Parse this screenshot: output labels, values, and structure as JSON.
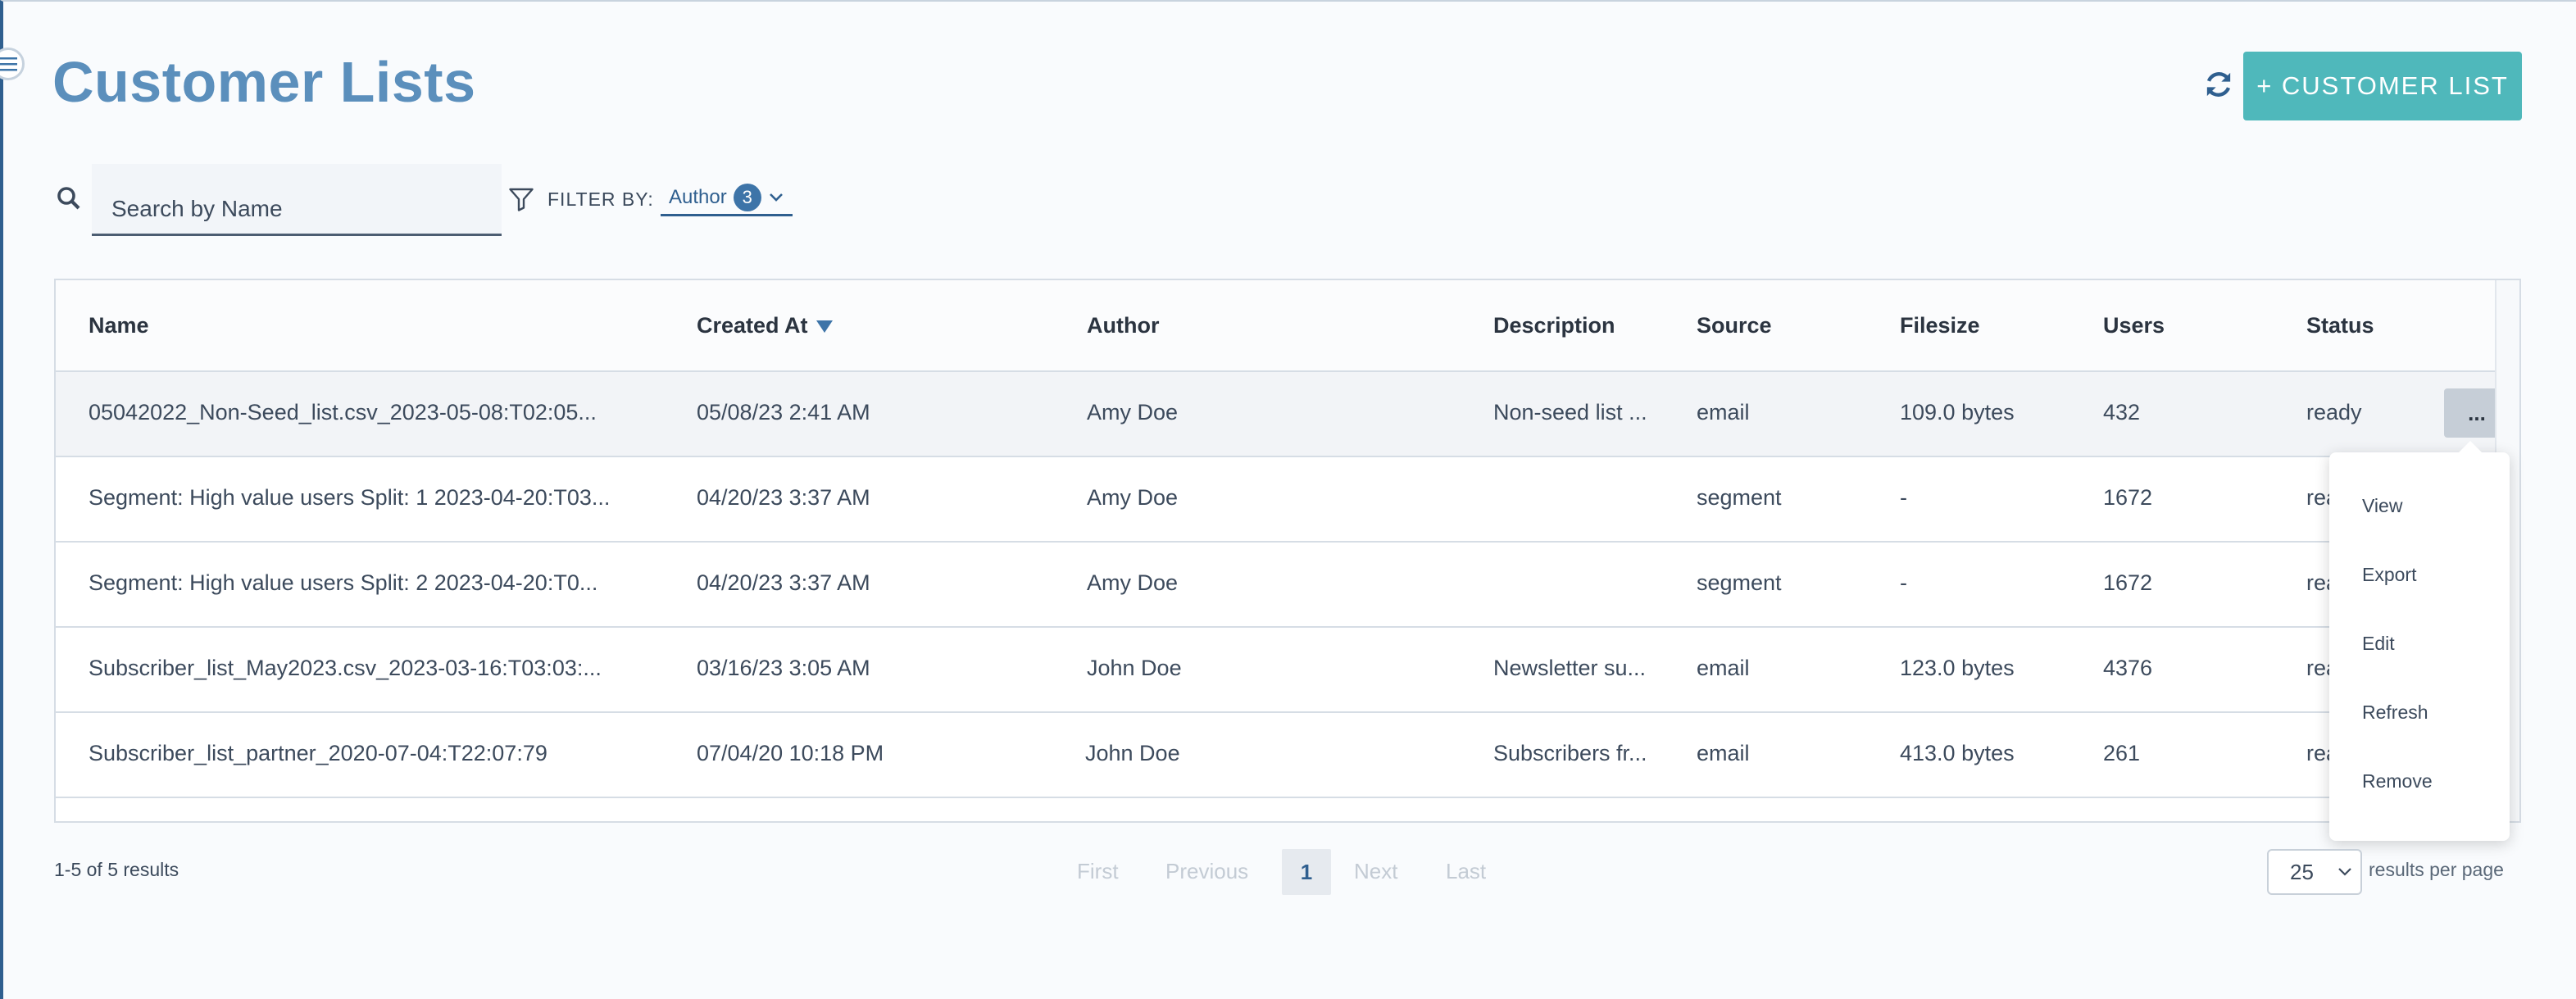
{
  "header": {
    "title": "Customer Lists",
    "add_button_label": "+ CUSTOMER LIST"
  },
  "toolbar": {
    "search_placeholder": "Search by Name",
    "filter_label": "FILTER BY:",
    "author_filter_label": "Author",
    "author_filter_count": "3"
  },
  "table": {
    "columns": [
      "Name",
      "Created At",
      "Author",
      "Description",
      "Source",
      "Filesize",
      "Users",
      "Status"
    ],
    "sort_column": "Created At",
    "rows": [
      {
        "name": "05042022_Non-Seed_list.csv_2023-05-08:T02:05...",
        "created_at": "05/08/23 2:41 AM",
        "author": "Amy Doe",
        "description": "Non-seed list ...",
        "source": "email",
        "filesize": "109.0 bytes",
        "users": "432",
        "status": "ready"
      },
      {
        "name": "Segment: High value users Split: 1 2023-04-20:T03...",
        "created_at": "04/20/23 3:37 AM",
        "author": "Amy Doe",
        "description": "",
        "source": "segment",
        "filesize": "-",
        "users": "1672",
        "status": "rea"
      },
      {
        "name": "Segment: High value users Split: 2 2023-04-20:T0...",
        "created_at": "04/20/23 3:37 AM",
        "author": "Amy Doe",
        "description": "",
        "source": "segment",
        "filesize": "-",
        "users": "1672",
        "status": "rea"
      },
      {
        "name": "Subscriber_list_May2023.csv_2023-03-16:T03:03:...",
        "created_at": "03/16/23 3:05 AM",
        "author": "John Doe",
        "description": "Newsletter su...",
        "source": "email",
        "filesize": "123.0 bytes",
        "users": "4376",
        "status": "rea"
      },
      {
        "name": "Subscriber_list_partner_2020-07-04:T22:07:79",
        "created_at": "07/04/20 10:18 PM",
        "author": "John Doe",
        "description": "Subscribers fr...",
        "source": "email",
        "filesize": "413.0 bytes",
        "users": "261",
        "status": "rea"
      }
    ],
    "more_label": "..."
  },
  "row_menu": {
    "items": [
      "View",
      "Export",
      "Edit",
      "Refresh",
      "Remove"
    ]
  },
  "footer": {
    "results_count": "1-5 of 5 results",
    "first": "First",
    "previous": "Previous",
    "current_page": "1",
    "next": "Next",
    "last": "Last",
    "per_page_value": "25",
    "per_page_label": "results per page"
  },
  "colors": {
    "title": "#5b8fbc",
    "primary_button": "#4fb8bb",
    "accent": "#3d74a8"
  }
}
